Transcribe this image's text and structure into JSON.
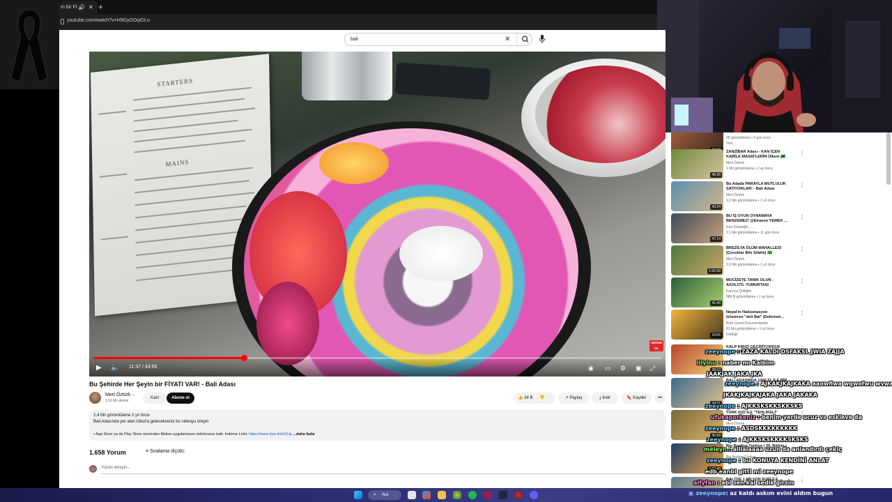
{
  "browser": {
    "tab_title": "ın bir Fİ",
    "url": "youtube.com/watch?v=H9GyDOqIDLo"
  },
  "search": {
    "query": "bali",
    "clear_icon": "close-icon",
    "search_icon": "search-icon",
    "mic_icon": "microphone-icon"
  },
  "player": {
    "time": "11:37 / 43:55",
    "progress_fraction": 0.2645,
    "watermark": "ABONE OL"
  },
  "video": {
    "title": "Bu Şehirde Her Şeyin bir FİYATI VAR! - Bali Adası",
    "channel": "Mert Öztürk",
    "verified": "✓",
    "subscribers": "1,53 Mn abone",
    "join_label": "Katıl",
    "subscribe_label": "Abone ol",
    "likes": "34 B",
    "share_label": "Paylaş",
    "download_label": "İndir",
    "save_label": "Kaydet",
    "more_label": "•••"
  },
  "description": {
    "stats": "2,4 Mn görüntüleme  2 yıl önce",
    "line1": "Bali Adasında yer alan Ubud'a gelecekseniz bu videoyu izleyin",
    "line2_prefix": "• App Store ya da Play Store üzerinden lifebox uygulamasını telefonuna indir. İndirme Linki: ",
    "line2_link": "https://www.kiss.link/ULip",
    "more": "...daha fazla"
  },
  "comments": {
    "count": "1.658 Yorum",
    "sort_label": "Sıralama ölçütü:",
    "add_placeholder": "Yorum ekleyin..."
  },
  "recommended": [
    {
      "title": "",
      "channel": "95 görüntüleme • 3 gün önce",
      "meta": "Yeni",
      "duration": "42:29"
    },
    {
      "title": "ZANZİBAR Adası - KAN İÇEN\nKABİLE MASAİ'LERİN Ülkesi 🇹🇿",
      "channel": "Mert Öztürk",
      "meta": "1 Mn görüntüleme • 2 ay önce",
      "duration": "45:26"
    },
    {
      "title": "Bu Adada PARAYLA MUTLULUK\nSATIYORLAR! - Bali Adası",
      "channel": "Mert Öztürk",
      "meta": "1,2 Mn görüntüleme • 1 yıl önce",
      "duration": "43:24"
    },
    {
      "title": "BU İŞ OYUN OYNAMAYA\nBENZEMEZ! @Elraenn YEMEK ...",
      "channel": "Enis Kirazoğlu",
      "meta": "2,1 Mn görüntüleme • 11 gün önce",
      "duration": "47:14"
    },
    {
      "title": "BREZİLYA ÖLÜM MAHALLESİ\n(Çocuklar Bile Silahlı) 🇧🇷",
      "channel": "Mert Öztürk",
      "meta": "2,6 Mn görüntüleme • 1 yıl önce",
      "duration": "1:02:39"
    },
    {
      "title": "MUCİZEYE TANIK OLUN -\nAXOLOTL YUMURTASI",
      "channel": "Karınca Çiftliğim",
      "meta": "589 B görüntüleme • 1 ay önce",
      "duration": "41:40"
    },
    {
      "title": "Nepal'in Halüsinasyon\nGösteren \"deli Bal\" (Delirmek...",
      "channel": "Ruhi Cenet Documentaries",
      "meta": "81 Mn görüntüleme • 1 yıl önce",
      "duration": "19:55",
      "badge": "Dublajlı"
    },
    {
      "title": "KALP KIRIZİ GEÇİRİYORDUK\nKORKUNÇ ADANIN SÜRPRİZİ...",
      "channel": "",
      "meta": "241 B görüntüleme • 4 gün önce",
      "duration": "28:10"
    },
    {
      "title": "BALİ ADASINDA 1000 TL İLE BİR\nGÜN GEÇİRMEK!",
      "channel": "",
      "meta": "2 Mn görüntüleme • 2 yıl önce",
      "duration": "34:21"
    },
    {
      "title": "TÜRK KIZI İLE \"TEHLİKELİ\"\nDesenler Gelecekmiş Malindani...",
      "channel": "Mert Öztürk",
      "meta": "1 Mn görüntüleme • 1 yıl önce",
      "duration": "41:59"
    },
    {
      "title": "Big Brother Türkiye | 39. Bölüm |\nBIG BROTHER",
      "channel": "Big Brother Türkiye",
      "meta": "",
      "duration": "1:02:49"
    },
    {
      "title": "BALİ'DE 1 MİLYON RUPİ İLE\nNE YAPILIR?",
      "channel": "",
      "meta": "",
      "duration": ""
    }
  ],
  "chat": [
    {
      "user": "zeeynope",
      "text": "ZAZA KALDI DSFAKSL JWIA ZAJJA"
    },
    {
      "user": "lilyinu",
      "text": "naber mı Kalbim"
    },
    {
      "user": "",
      "text": "JAAKJAK JAKA JKA"
    },
    {
      "user": "zeeynope",
      "text": "AJKAKJKAJKAKA aaowfiwa wqwofwu wvwaaowfw aw"
    },
    {
      "user": "",
      "text": "JKAKJKAJKAJAKA JAKA JAKAKA"
    },
    {
      "user": "zeeynope",
      "text": "AJKKSKSKKSKKSKS"
    },
    {
      "user": "ufukaporkeniz",
      "text": "benim yerde ucuz vs eskieve da"
    },
    {
      "user": "zeeynope",
      "text": "ASDSKKKKKKKKK"
    },
    {
      "user": "zeeynope",
      "text": "AJKKSKSKKKKSKSKS"
    },
    {
      "user": "meleyn",
      "text": "alllalaaaa uzun da anlandırdı çekiç"
    },
    {
      "user": "zeeynope",
      "text": "bu KONUYA KENDİNİ ANLAT"
    },
    {
      "user": "",
      "text": "edb eanbl gitti mi zeeynope"
    },
    {
      "user": "alfyfan",
      "text": "abi sen kal sedik girsin"
    }
  ],
  "chat_bottom": {
    "user": "zeeynope",
    "text": ": az kaldı askım evini aldım bugun"
  },
  "taskbar": {
    "search_label": "Ara"
  }
}
